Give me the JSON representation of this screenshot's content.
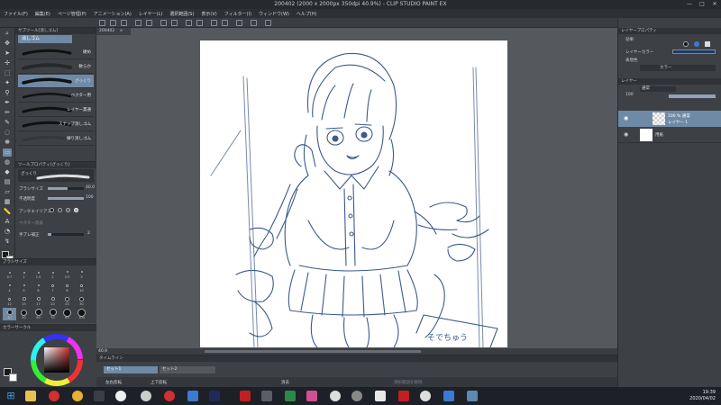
{
  "window": {
    "title": "200402 (2000 x 2000px 350dpi 40.9%) - CLIP STUDIO PAINT EX",
    "controls": [
      "—",
      "□",
      "✕"
    ]
  },
  "menu": [
    "ファイル(F)",
    "編集(E)",
    "ページ管理(P)",
    "アニメーション(A)",
    "レイヤー(L)",
    "選択範囲(S)",
    "表示(V)",
    "フィルター(I)",
    "ウィンドウ(W)",
    "ヘルプ(H)"
  ],
  "subtool": {
    "header": "サブツール[消しゴム]",
    "tab": "消しゴム",
    "brushes": [
      {
        "label": "硬め"
      },
      {
        "label": "軟らか"
      },
      {
        "label": "ざっくり"
      },
      {
        "label": "ベクター用"
      },
      {
        "label": "レイヤー貫通"
      },
      {
        "label": "スナップ消しゴム"
      },
      {
        "label": "練り消しゴム"
      }
    ],
    "selected_index": 2
  },
  "tool_property": {
    "header": "ツールプロパティ[ざっくり]",
    "preview_label": "ざっくり",
    "brush_size_label": "ブラシサイズ",
    "brush_size_value": "40.0",
    "opacity_label": "不透明度",
    "opacity_value": "100",
    "antialias_label": "アンチエイリアス",
    "vector_erase_label": "ベクター消去",
    "stabilization_label": "手ブレ補正",
    "stabilization_value": "2"
  },
  "brush_size_panel": {
    "header": "ブラシサイズ",
    "sizes": [
      "0.7",
      "1",
      "1.5",
      "2",
      "2.5",
      "3",
      "4",
      "5",
      "6",
      "7",
      "8",
      "10",
      "12",
      "15",
      "17",
      "20",
      "25",
      "30",
      "40",
      "50",
      "60",
      "70",
      "80",
      "100"
    ],
    "selected": "40"
  },
  "color_panel": {
    "header": "カラーサークル",
    "main_color": "#1a1a1a",
    "sub_color": "#ffffff",
    "hue_color": "#c03030"
  },
  "document": {
    "tab_label": "200402",
    "zoom": "40.9",
    "canvas_px": "2000 x 2000px",
    "sketch_note": "そでちゅう"
  },
  "timeline": {
    "header": "タイムライン",
    "tracks": [
      "セット1",
      "セット2"
    ],
    "buttons": [
      "左右反転",
      "上下反転",
      "消去",
      "選択範囲を解除"
    ]
  },
  "layer_property": {
    "header": "レイヤープロパティ",
    "effect_label": "効果",
    "layer_color_label": "レイヤーカラー",
    "expression_label": "表現色",
    "expression_value": "カラー"
  },
  "layers": {
    "header": "レイヤー",
    "blend": "通常",
    "opacity": "100",
    "items": [
      {
        "name": "レイヤー 1",
        "sub": "100 % 通常"
      },
      {
        "name": "用紙",
        "sub": ""
      }
    ]
  },
  "taskbar": {
    "time": "19:39",
    "date": "2020/04/02"
  },
  "colors": {
    "accent": "#6f8aa6",
    "sketch_line": "#3d5a8a",
    "panel_bg": "#3d4045"
  }
}
